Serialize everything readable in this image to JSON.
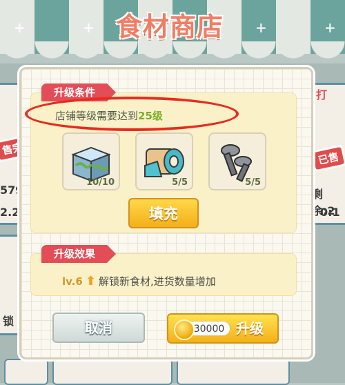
{
  "shop": {
    "title": "食材商店"
  },
  "background": {
    "left_card": {
      "badge": "售完",
      "number": "579",
      "price": "2.2",
      "lock_text": "锁"
    },
    "right_card": {
      "badge": "已售",
      "tab_text": "打",
      "remaining": "剩余:2",
      "time": "0:1"
    }
  },
  "dialog": {
    "conditions": {
      "tab_label": "升级条件",
      "text_prefix": "店铺等级需要达到",
      "level_value": "25级",
      "items": [
        {
          "icon": "ice-box-icon",
          "count": "10/10"
        },
        {
          "icon": "tape-roll-icon",
          "count": "5/5"
        },
        {
          "icon": "screws-icon",
          "count": "5/5"
        }
      ],
      "fill_button": "填充"
    },
    "effects": {
      "tab_label": "升级效果",
      "level": "lv.6",
      "text": "解锁新食材,进货数量增加"
    },
    "cancel_button": "取消",
    "upgrade": {
      "cost": "30000",
      "label": "升级"
    }
  },
  "colors": {
    "tab_red": "#e24d57",
    "level_green": "#7aae2d",
    "highlight_red": "#e82b1f",
    "button_gold": "#f4b019"
  }
}
